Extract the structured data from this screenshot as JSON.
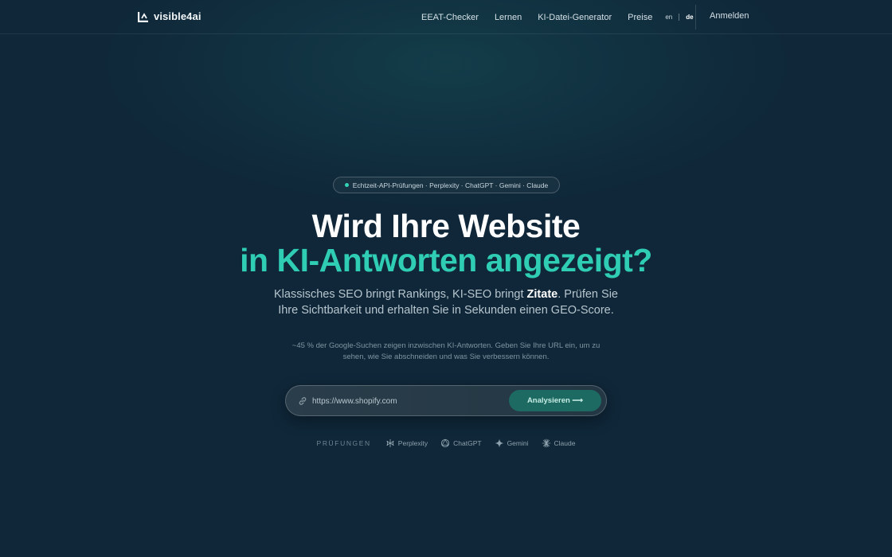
{
  "brand": {
    "name": "visible4ai"
  },
  "nav": {
    "links": [
      "EEAT-Checker",
      "Lernen",
      "KI-Datei-Generator",
      "Preise"
    ],
    "languages": [
      "en",
      "de"
    ],
    "active_language": "de",
    "login_label": "Anmelden"
  },
  "hero": {
    "pill_text": "Echtzeit-API-Prüfungen · Perplexity · ChatGPT · Gemini · Claude",
    "title_line1": "Wird Ihre Website",
    "title_line2": "in KI-Antworten angezeigt?",
    "subtitle_prefix": "Klassisches SEO bringt Rankings, KI-SEO bringt",
    "subtitle_strong": "Zitate",
    "subtitle_suffix": ". Prüfen Sie Ihre Sichtbarkeit und erhalten Sie in Sekunden einen GEO-Score.",
    "note": "~45 % der Google-Suchen zeigen inzwischen KI-Antworten. Geben Sie Ihre URL ein, um zu sehen, wie Sie abschneiden und was Sie verbessern können."
  },
  "search": {
    "value": "https://www.shopify.com",
    "button_label": "Analysieren ⟶"
  },
  "checks": {
    "label": "PRÜFUNGEN",
    "providers": [
      {
        "name": "Perplexity",
        "icon": "perplexity-icon"
      },
      {
        "name": "ChatGPT",
        "icon": "chatgpt-icon"
      },
      {
        "name": "Gemini",
        "icon": "gemini-icon"
      },
      {
        "name": "Claude",
        "icon": "claude-icon"
      }
    ]
  },
  "colors": {
    "background": "#0f2739",
    "accent": "#2fcdb3",
    "button": "#1d6a62"
  }
}
